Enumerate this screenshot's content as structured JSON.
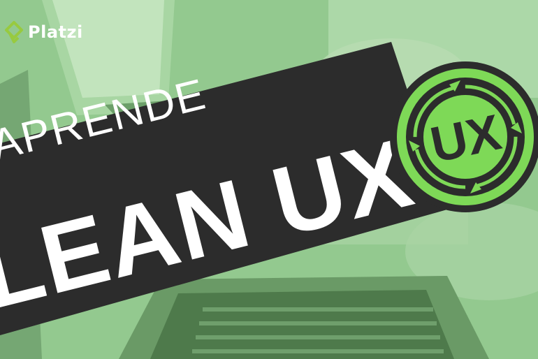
{
  "brand": {
    "name": "Platzi",
    "accent": "#98ca3f"
  },
  "banner": {
    "line1": "APRENDE",
    "line2": "LEAN UX",
    "stripe_color": "#2c2c2c",
    "text_color": "#ffffff"
  },
  "badge": {
    "label": "UX",
    "ring_color": "#7ed957",
    "inner_color": "#2c2c2c"
  },
  "icons": [
    "platzi-logo-icon",
    "refresh-cycle-icon"
  ]
}
